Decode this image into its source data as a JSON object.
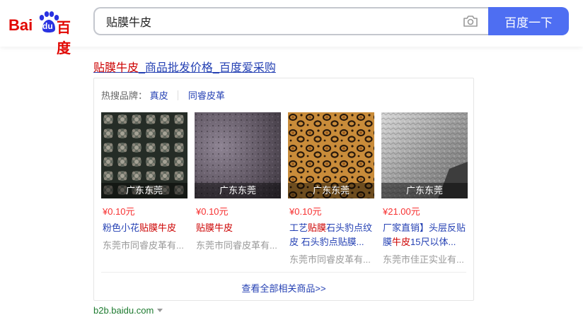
{
  "logo": {
    "bai": "Bai",
    "du": "du",
    "cn": "百度"
  },
  "search": {
    "query": "贴膜牛皮",
    "button": "百度一下"
  },
  "result": {
    "title_highlight": "贴膜牛皮",
    "title_rest": "_商品批发价格_百度爱采购"
  },
  "brands": {
    "label": "热搜品牌：",
    "items": [
      "真皮",
      "同睿皮革"
    ]
  },
  "products": [
    {
      "location": "广东东莞",
      "price": "¥0.10元",
      "name_parts": [
        "粉色小花",
        "贴膜牛皮",
        ""
      ],
      "company": "东莞市同睿皮革有..."
    },
    {
      "location": "广东东莞",
      "price": "¥0.10元",
      "name_parts": [
        "",
        "贴膜牛皮",
        ""
      ],
      "company": "东莞市同睿皮革有..."
    },
    {
      "location": "广东东莞",
      "price": "¥0.10元",
      "name_parts": [
        "工艺",
        "贴膜",
        "石头豹点纹皮 石头豹点贴膜..."
      ],
      "company": "东莞市同睿皮革有..."
    },
    {
      "location": "广东东莞",
      "price": "¥21.00元",
      "name_parts": [
        "厂家直销】头层反贴膜",
        "牛皮",
        "15尺以体..."
      ],
      "company": "东莞市佳正实业有..."
    }
  ],
  "more_link": "查看全部相关商品>>",
  "site": "b2b.baidu.com",
  "colors": {
    "accent": "#4e6ef2",
    "link": "#2440b3",
    "highlight": "#c00000",
    "price": "#f73131",
    "site": "#1e7b30"
  },
  "icons": {
    "camera": "camera-icon",
    "paw": "baidu-paw-icon",
    "caret": "caret-down-icon"
  }
}
